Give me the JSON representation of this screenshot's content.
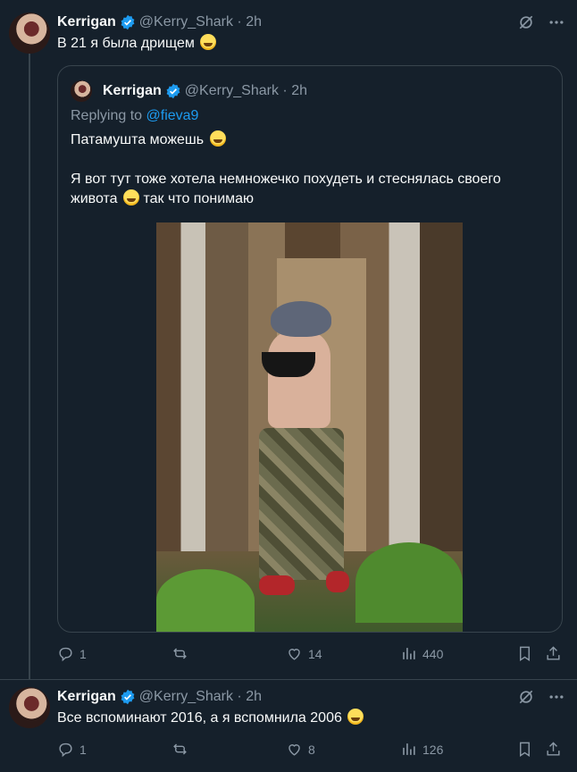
{
  "post1": {
    "author": {
      "name": "Kerrigan",
      "handle": "@Kerry_Shark",
      "time": "2h"
    },
    "text": "В 21 я была дрищем",
    "emoji": "grin-emoji",
    "quote": {
      "author": {
        "name": "Kerrigan",
        "handle": "@Kerry_Shark",
        "time": "2h"
      },
      "replying_label": "Replying to",
      "replying_to": "@fieva9",
      "line1": "Патамушта можешь",
      "line2a": "Я вот тут тоже хотела немножечко похудеть и стеснялась своего",
      "line2b": "живота",
      "line2c": "так что понимаю"
    },
    "actions": {
      "replies": "1",
      "reposts": "",
      "likes": "14",
      "views": "440"
    }
  },
  "post2": {
    "author": {
      "name": "Kerrigan",
      "handle": "@Kerry_Shark",
      "time": "2h"
    },
    "text": "Все вспоминают 2016, а я вспомнила 2006",
    "actions": {
      "replies": "1",
      "reposts": "",
      "likes": "8",
      "views": "126"
    }
  },
  "colors": {
    "background": "#15202b",
    "text": "#f7f9f9",
    "muted": "#8b98a5",
    "accent": "#1d9bf0",
    "border": "#38444d"
  }
}
